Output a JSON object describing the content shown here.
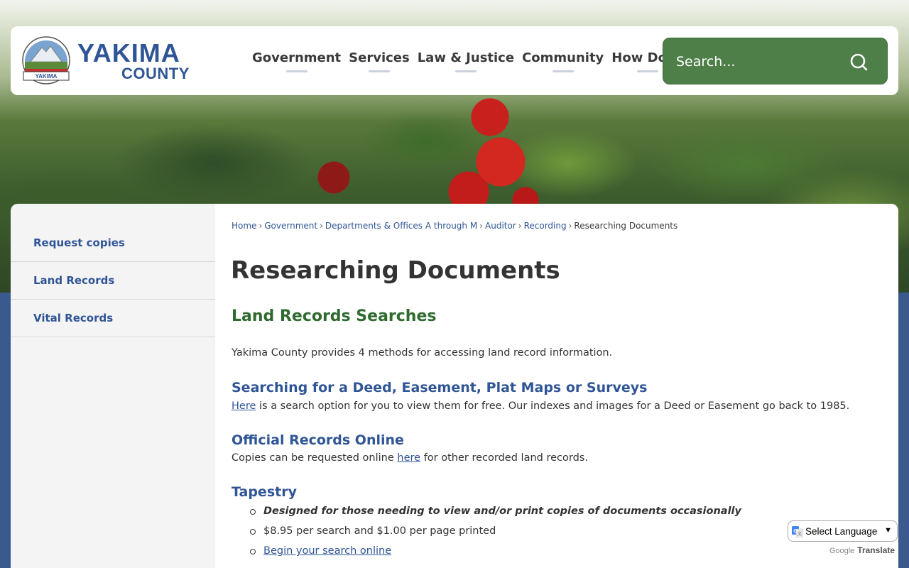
{
  "logo": {
    "name_line1": "YAKIMA",
    "name_line2": "COUNTY",
    "seal_text": "YAKIMA"
  },
  "nav": [
    {
      "label": "Government"
    },
    {
      "label": "Services"
    },
    {
      "label": "Law & Justice"
    },
    {
      "label": "Community"
    },
    {
      "label": "How Do I?"
    }
  ],
  "search": {
    "placeholder": "Search..."
  },
  "sidebar": {
    "items": [
      {
        "label": "Request copies"
      },
      {
        "label": "Land Records"
      },
      {
        "label": "Vital Records"
      }
    ]
  },
  "breadcrumb": {
    "links": [
      "Home",
      "Government",
      "Departments & Offices A through M",
      "Auditor",
      "Recording"
    ],
    "current": "Researching Documents",
    "separator": "›"
  },
  "page": {
    "title": "Researching Documents",
    "section_heading": "Land Records Searches",
    "intro": "Yakima County provides 4 methods for accessing land record information.",
    "deed": {
      "heading": "Searching for a Deed, Easement, Plat Maps or Surveys",
      "link": "Here",
      "text": " is a search option for you to view them for free.  Our indexes and images for a Deed or Easement go back to 1985."
    },
    "official": {
      "heading": "Official Records Online",
      "text_before": "Copies can be requested online ",
      "link": "here",
      "text_after": " for other recorded land records."
    },
    "tapestry": {
      "heading": "Tapestry",
      "bullet1": "Designed for those needing to view and/or print copies of documents occasionally",
      "bullet2": "$8.95 per search and $1.00 per page printed",
      "bullet3_link": "Begin your search online"
    }
  },
  "translate": {
    "select_label": "Select Language",
    "powered_by": "Google",
    "translate_label": "Translate"
  },
  "colors": {
    "brand_blue": "#2f5596",
    "green": "#4e7f48",
    "heading_green": "#2f6a2f"
  }
}
